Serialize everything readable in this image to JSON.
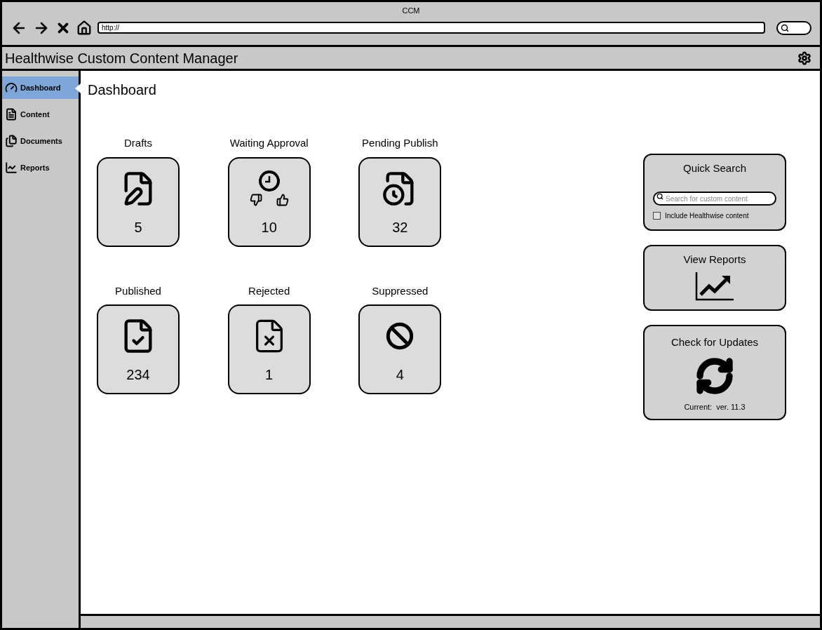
{
  "browser": {
    "title": "CCM",
    "url": "http://"
  },
  "app": {
    "title": "Healthwise Custom Content Manager"
  },
  "sidebar": {
    "items": [
      {
        "label": "Dashboard",
        "kind": "dashboard",
        "selected": true
      },
      {
        "label": "Content",
        "kind": "content",
        "selected": false
      },
      {
        "label": "Documents",
        "kind": "documents",
        "selected": false
      },
      {
        "label": "Reports",
        "kind": "reports",
        "selected": false
      }
    ]
  },
  "page": {
    "title": "Dashboard"
  },
  "tiles": [
    {
      "label": "Drafts",
      "count": "5",
      "kind": "drafts"
    },
    {
      "label": "Waiting Approval",
      "count": "10",
      "kind": "approval"
    },
    {
      "label": "Pending Publish",
      "count": "32",
      "kind": "pending"
    },
    {
      "label": "Published",
      "count": "234",
      "kind": "published"
    },
    {
      "label": "Rejected",
      "count": "1",
      "kind": "rejected"
    },
    {
      "label": "Suppressed",
      "count": "4",
      "kind": "suppressed"
    }
  ],
  "quick_search": {
    "title": "Quick Search",
    "placeholder": "Search for custom content",
    "include_label": "Include Healthwise content",
    "checked": false
  },
  "view_reports": {
    "title": "View Reports"
  },
  "updates": {
    "title": "Check for Updates",
    "version": "Current:  ver. 11.3"
  }
}
